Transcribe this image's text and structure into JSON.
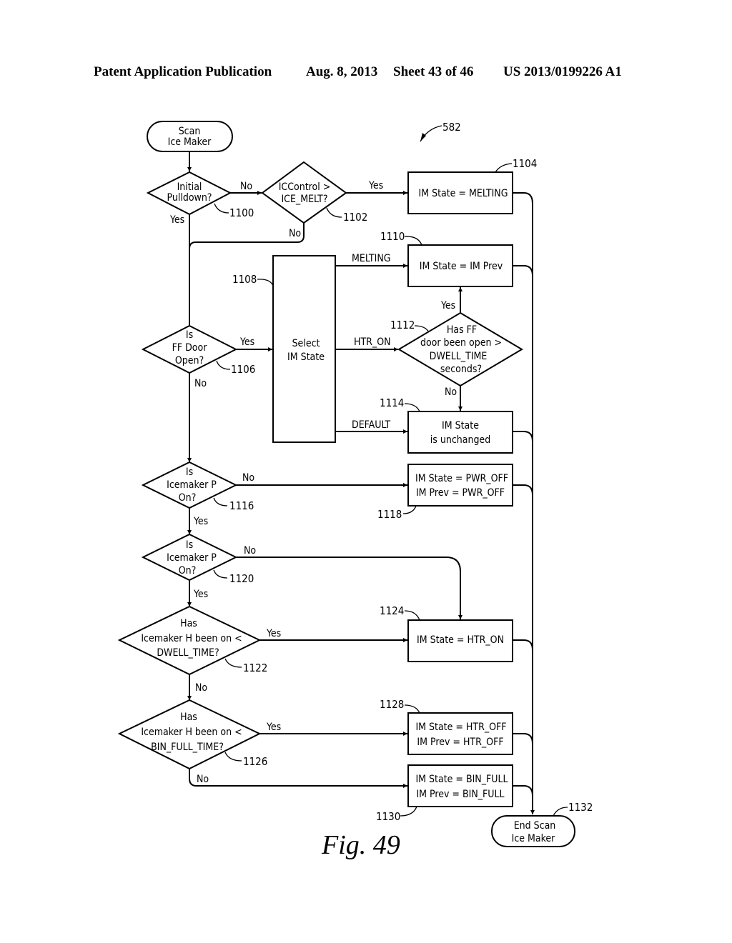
{
  "header": {
    "publication": "Patent Application Publication",
    "date": "Aug. 8, 2013",
    "sheet": "Sheet 43 of 46",
    "number": "US 2013/0199226 A1"
  },
  "figure": {
    "label": "Fig. 49",
    "ref": "582"
  },
  "nodes": {
    "start": {
      "lines": [
        "Scan",
        "Ice Maker"
      ]
    },
    "d1100": {
      "ref": "1100",
      "lines": [
        "Initial",
        "Pulldown?"
      ]
    },
    "d1102": {
      "ref": "1102",
      "lines": [
        "ICControl >",
        "ICE_MELT?"
      ]
    },
    "p1104": {
      "ref": "1104",
      "lines": [
        "IM State = MELTING"
      ]
    },
    "d1106": {
      "ref": "1106",
      "lines": [
        "Is",
        "FF Door",
        "Open?"
      ]
    },
    "p1108": {
      "ref": "1108",
      "lines": [
        "Select",
        "IM State"
      ]
    },
    "p1110": {
      "ref": "1110",
      "lines": [
        "IM State = IM Prev"
      ]
    },
    "d1112": {
      "ref": "1112",
      "lines": [
        "Has FF",
        "door been open >",
        "DWELL_TIME",
        "seconds?"
      ]
    },
    "p1114": {
      "ref": "1114",
      "lines": [
        "IM State",
        "is unchanged"
      ]
    },
    "d1116": {
      "ref": "1116",
      "lines": [
        "Is",
        "Icemaker P",
        "On?"
      ]
    },
    "p1118": {
      "ref": "1118",
      "lines": [
        "IM State = PWR_OFF",
        "IM Prev = PWR_OFF"
      ]
    },
    "d1120": {
      "ref": "1120",
      "lines": [
        "Is",
        "Icemaker P",
        "On?"
      ]
    },
    "d1122": {
      "ref": "1122",
      "lines": [
        "Has",
        "Icemaker H been on <",
        "DWELL_TIME?"
      ]
    },
    "p1124": {
      "ref": "1124",
      "lines": [
        "IM State = HTR_ON"
      ]
    },
    "d1126": {
      "ref": "1126",
      "lines": [
        "Has",
        "Icemaker H been on <",
        "BIN_FULL_TIME?"
      ]
    },
    "p1128": {
      "ref": "1128",
      "lines": [
        "IM State = HTR_OFF",
        "IM Prev = HTR_OFF"
      ]
    },
    "p1130": {
      "ref": "1130",
      "lines": [
        "IM State = BIN_FULL",
        "IM Prev = BIN_FULL"
      ]
    },
    "end": {
      "ref": "1132",
      "lines": [
        "End Scan",
        "Ice Maker"
      ]
    }
  },
  "edge_labels": {
    "d1100_no": "No",
    "d1100_yes": "Yes",
    "d1102_yes": "Yes",
    "d1102_no": "No",
    "d1106_yes": "Yes",
    "d1106_no": "No",
    "melting": "MELTING",
    "htr_on": "HTR_ON",
    "default": "DEFAULT",
    "d1112_yes": "Yes",
    "d1112_no": "No",
    "d1116_no": "No",
    "d1116_yes": "Yes",
    "d1120_no": "No",
    "d1120_yes": "Yes",
    "d1122_yes": "Yes",
    "d1122_no": "No",
    "d1126_yes": "Yes",
    "d1126_no": "No"
  }
}
